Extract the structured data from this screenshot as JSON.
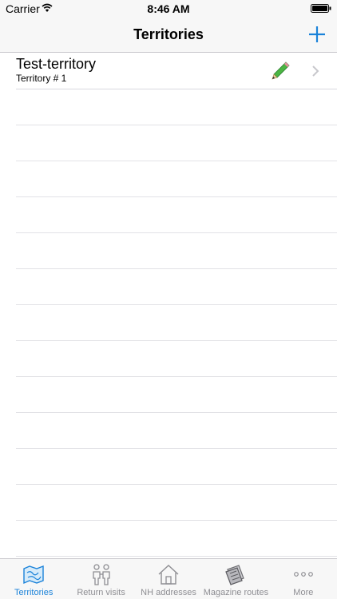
{
  "status_bar": {
    "carrier": "Carrier",
    "time": "8:46 AM"
  },
  "nav": {
    "title": "Territories",
    "add_icon": "plus-icon"
  },
  "territories": [
    {
      "name": "Test-territory",
      "number": "Territory # 1"
    }
  ],
  "tabs": [
    {
      "label": "Territories",
      "icon": "map-icon",
      "active": true
    },
    {
      "label": "Return visits",
      "icon": "people-icon",
      "active": false
    },
    {
      "label": "NH addresses",
      "icon": "house-icon",
      "active": false
    },
    {
      "label": "Magazine routes",
      "icon": "magazines-icon",
      "active": false
    },
    {
      "label": "More",
      "icon": "more-icon",
      "active": false
    }
  ],
  "colors": {
    "accent": "#1a82d9",
    "inactive": "#8e8e93",
    "separator": "#d9d9de"
  }
}
